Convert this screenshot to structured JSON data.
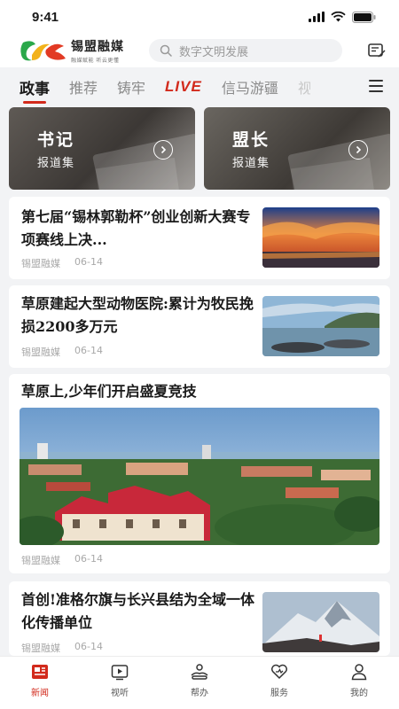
{
  "status_bar": {
    "time": "9:41"
  },
  "header": {
    "logo_name": "锡盟融媒",
    "logo_slogan": "融媒赋能  听云更懂",
    "search_placeholder": "数字文明发展"
  },
  "tabs": [
    {
      "label": "政事",
      "active": true
    },
    {
      "label": "推荐"
    },
    {
      "label": "铸牢"
    },
    {
      "label": "LIVE"
    },
    {
      "label": "信马游疆"
    },
    {
      "label": "视"
    }
  ],
  "promos": [
    {
      "title": "书记",
      "subtitle": "报道集"
    },
    {
      "title": "盟长",
      "subtitle": "报道集"
    }
  ],
  "news": [
    {
      "title": "第七届“锡林郭勒杯”创业创新大赛专项赛线上决...",
      "source": "锡盟融媒",
      "date": "06-14"
    },
    {
      "title": "草原建起大型动物医院:累计为牧民挽损2200多万元",
      "source": "锡盟融媒",
      "date": "06-14"
    },
    {
      "title": "草原上,少年们开启盛夏竞技",
      "source": "锡盟融媒",
      "date": "06-14"
    },
    {
      "title": "首创!准格尔旗与长兴县结为全域一体化传播单位",
      "source": "锡盟融媒",
      "date": "06-14"
    }
  ],
  "tabbar": [
    {
      "label": "新闻",
      "icon": "news-icon",
      "active": true
    },
    {
      "label": "视听",
      "icon": "video-icon"
    },
    {
      "label": "帮办",
      "icon": "help-icon"
    },
    {
      "label": "服务",
      "icon": "service-heart-icon"
    },
    {
      "label": "我的",
      "icon": "profile-icon"
    }
  ],
  "colors": {
    "accent": "#d22a1c",
    "background": "#f2f3f5"
  }
}
